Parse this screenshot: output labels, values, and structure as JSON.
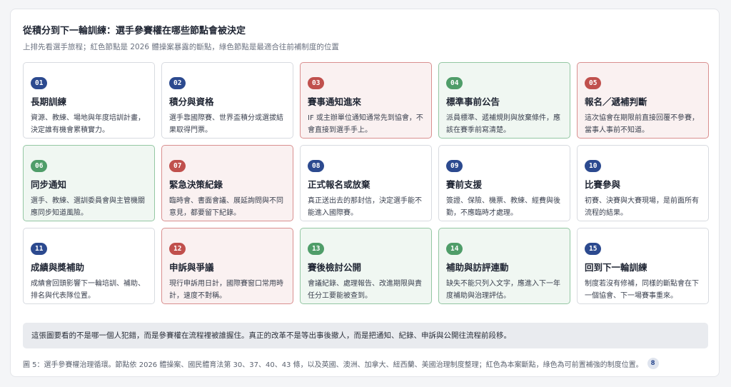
{
  "header": {
    "title": "從積分到下一輪訓練：選手參賽權在哪些節點會被決定",
    "subtitle": "上排先看選手旅程；紅色節點是 2026 體操案暴露的斷點，綠色節點是最適合往前補制度的位置"
  },
  "colors": {
    "neutral_badge": "#2c4a8f",
    "red_badge": "#c0504d",
    "green_badge": "#4f9d69",
    "red_card_bg": "#faf1f1",
    "green_card_bg": "#f0f7f2"
  },
  "steps": [
    {
      "num": "01",
      "title": "長期訓練",
      "desc": "資源、教練、場地與年度培訓計畫，決定誰有機會累積實力。",
      "status": "neutral"
    },
    {
      "num": "02",
      "title": "積分與資格",
      "desc": "選手靠國際賽、世界盃積分或選拔結果取得門票。",
      "status": "neutral"
    },
    {
      "num": "03",
      "title": "賽事通知進來",
      "desc": "IF 或主辦單位通知通常先到協會，不會直接到選手手上。",
      "status": "red"
    },
    {
      "num": "04",
      "title": "標準事前公告",
      "desc": "派員標準、遞補規則與放棄條件，應該在賽季前寫清楚。",
      "status": "green"
    },
    {
      "num": "05",
      "title": "報名／遞補判斷",
      "desc": "這次協會在期限前直接回覆不參賽，當事人事前不知道。",
      "status": "red"
    },
    {
      "num": "06",
      "title": "同步通知",
      "desc": "選手、教練、選訓委員會與主管機關應同步知道風險。",
      "status": "green"
    },
    {
      "num": "07",
      "title": "緊急決策紀錄",
      "desc": "臨時會、書面會議、展延詢問與不同意見，都要留下紀錄。",
      "status": "red"
    },
    {
      "num": "08",
      "title": "正式報名或放棄",
      "desc": "真正送出去的那封信，決定選手能不能進入國際賽。",
      "status": "neutral"
    },
    {
      "num": "09",
      "title": "賽前支援",
      "desc": "簽證、保險、機票、教練、經費與後勤，不應臨時才處理。",
      "status": "neutral"
    },
    {
      "num": "10",
      "title": "比賽參與",
      "desc": "初賽、決賽與大賽現場，是前面所有流程的結果。",
      "status": "neutral"
    },
    {
      "num": "11",
      "title": "成績與獎補助",
      "desc": "成績會回頭影響下一輪培訓、補助、排名與代表隊位置。",
      "status": "neutral"
    },
    {
      "num": "12",
      "title": "申訴與爭議",
      "desc": "現行申訴用日計，國際賽窗口常用時計，速度不對稱。",
      "status": "red"
    },
    {
      "num": "13",
      "title": "賽後檢討公開",
      "desc": "會議紀錄、處理報告、改進期限與責任分工要能被查到。",
      "status": "green"
    },
    {
      "num": "14",
      "title": "補助與訪評連動",
      "desc": "缺失不能只列入文字，應進入下一年度補助與治理評估。",
      "status": "green"
    },
    {
      "num": "15",
      "title": "回到下一輪訓練",
      "desc": "制度若沒有修補，同樣的斷點會在下一個協會、下一場賽事重來。",
      "status": "neutral"
    }
  ],
  "note": "這張圖要看的不是哪一個人犯錯，而是參賽權在流程裡被誰握住。真正的改革不是等出事後撤人，而是把通知、紀錄、申訴與公開往流程前段移。",
  "caption": {
    "text": "圖 5：選手參賽權治理循環。節點依 2026 體操案、國民體育法第 30、37、40、43 條，以及英國、澳洲、加拿大、紐西蘭、美國治理制度整理；紅色為本案斷點，綠色為可前置補強的制度位置。",
    "ref": "8"
  }
}
